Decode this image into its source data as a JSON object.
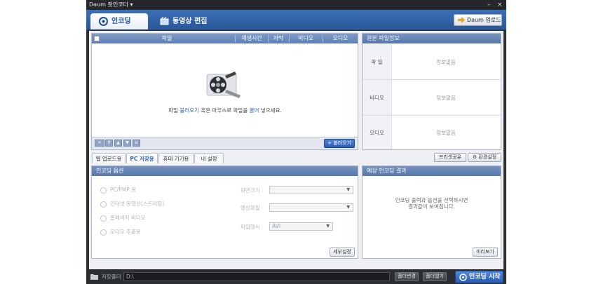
{
  "app": {
    "title": "Daum 팟인코더 ▾"
  },
  "main_tabs": [
    {
      "label": "인코딩",
      "active": true
    },
    {
      "label": "동영상 편집",
      "active": false
    }
  ],
  "header_button": {
    "label": "Daum 업로드"
  },
  "file_list": {
    "columns": [
      "파일",
      "재생시간",
      "자막",
      "비디오",
      "오디오"
    ],
    "hint_prefix": "파일 ",
    "hint_link1": "불러오기",
    "hint_middle": " 혹은 마우스로 파일을 ",
    "hint_link2": "끌어",
    "hint_suffix": " 넣으세요.",
    "bottom_icons": [
      "delete-icon",
      "move-top-icon",
      "move-up-icon",
      "move-down-icon",
      "move-bottom-icon"
    ],
    "load_button": "불러오기"
  },
  "source_info": {
    "title": "원본 파일정보",
    "rows": [
      {
        "label": "파 일",
        "value": "정보없음"
      },
      {
        "label": "비디오",
        "value": "정보없음"
      },
      {
        "label": "오디오",
        "value": "정보없음"
      }
    ]
  },
  "sub_tabs": [
    {
      "label": "웹 업로드용",
      "active": false
    },
    {
      "label": "PC 저장용",
      "active": true
    },
    {
      "label": "휴대 기기용",
      "active": false
    },
    {
      "label": "내 설정",
      "active": false
    }
  ],
  "right_buttons": {
    "preset_share": "프리셋공유",
    "settings": "환경설정"
  },
  "encoding_options": {
    "title": "인코딩 옵션",
    "radios": [
      "PC/PMP 용",
      "인터넷 동영상(스트리밍)",
      "홈페이지 비디오",
      "오디오 추출용"
    ],
    "fields": [
      {
        "label": "화면크기",
        "value": ""
      },
      {
        "label": "영상화질",
        "value": ""
      },
      {
        "label": "파일형식",
        "value": "AVI"
      }
    ],
    "detail_button": "세부설정"
  },
  "expected_result": {
    "title": "예상 인코딩 결과",
    "text_line1": "인코딩 출력과 옵션을 선택하시면",
    "text_line2": "결과값이 보여집니다.",
    "preview_button": "미리보기"
  },
  "bottom_bar": {
    "save_folder_label": "저장폴더",
    "save_path": "D:\\",
    "change_folder": "폴더변경",
    "open_folder": "폴더열기",
    "start_button": "인코딩 시작"
  },
  "colors": {
    "accent": "#2a62c9",
    "header_blue": "#3a6fb7",
    "dark_bg": "#2b2e33"
  }
}
